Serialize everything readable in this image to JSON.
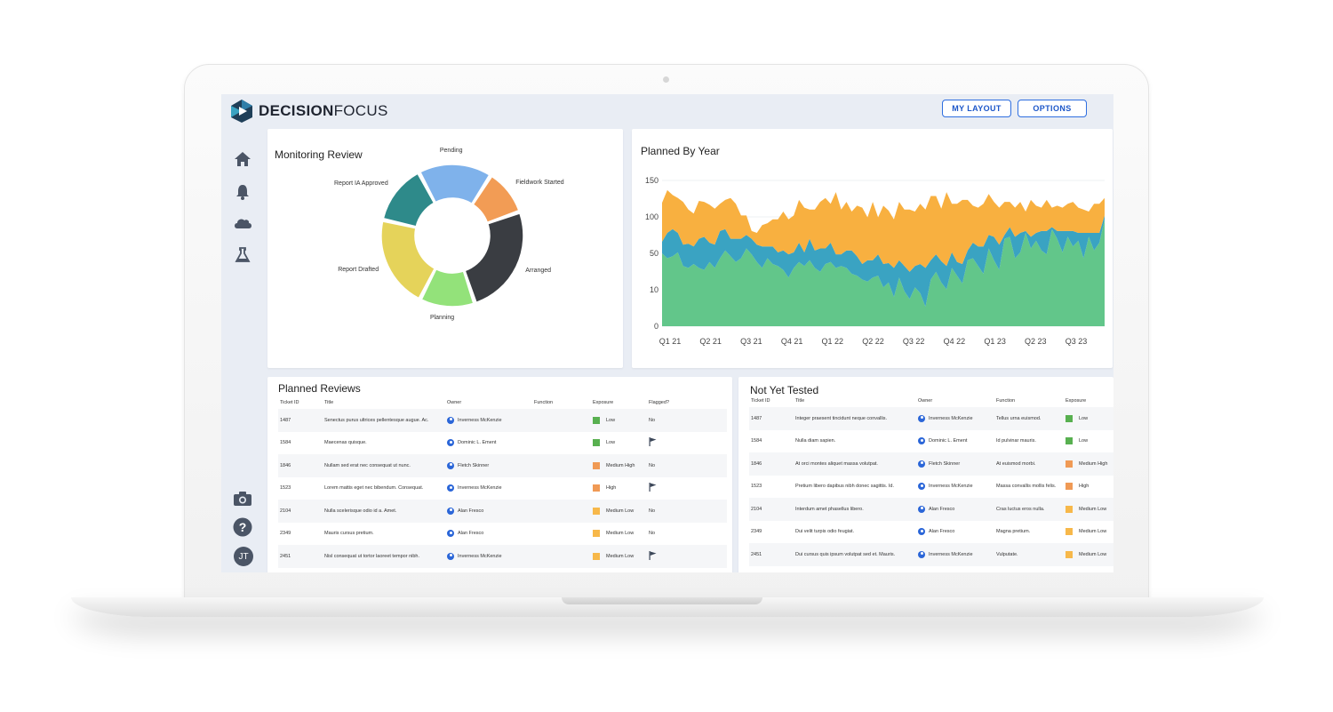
{
  "brand": {
    "name_bold": "DECISION",
    "name_light": "FOCUS"
  },
  "header": {
    "my_layout": "MY LAYOUT",
    "options": "OPTIONS"
  },
  "user": {
    "initials": "JT"
  },
  "icons": [
    "home-icon",
    "bell-icon",
    "cloud-icon",
    "flask-icon",
    "camera-icon",
    "help-icon"
  ],
  "colors": {
    "accent": "#2e6ee0",
    "green": "#62c68a",
    "teal": "#3aa3c2",
    "orange": "#f8b040",
    "exposure_low": "#58b050",
    "exposure_medium_high": "#f09a55",
    "exposure_high": "#f09a55",
    "exposure_medium_low": "#f7b84a"
  },
  "monitoring": {
    "title": "Monitoring Review",
    "chart_data": {
      "type": "pie",
      "donut": true,
      "segments": [
        {
          "label": "Pending",
          "value": 16,
          "color": "#7fb2eb"
        },
        {
          "label": "Fieldwork Started",
          "value": 10,
          "color": "#f29c55"
        },
        {
          "label": "Arranged",
          "value": 24,
          "color": "#3a3d42"
        },
        {
          "label": "Planning",
          "value": 12,
          "color": "#93e27a"
        },
        {
          "label": "Report Drafted",
          "value": 20,
          "color": "#e5d35a"
        },
        {
          "label": "Report IA Approved",
          "value": 13,
          "color": "#2e8a8a"
        }
      ]
    }
  },
  "planned_by_year": {
    "title": "Planned By Year",
    "chart_data": {
      "type": "area",
      "stacked": true,
      "x_categories": [
        "Q1 21",
        "Q2 21",
        "Q3 21",
        "Q4 21",
        "Q1 22",
        "Q2 22",
        "Q3 22",
        "Q4 22",
        "Q1 23",
        "Q2 23",
        "Q3 23"
      ],
      "y_ticks": [
        "0",
        "10",
        "50",
        "100",
        "150"
      ],
      "ylim": [
        0,
        150
      ],
      "series": [
        {
          "color": "#62c68a",
          "values": [
            75,
            70,
            72,
            76,
            62,
            60,
            64,
            60,
            58,
            66,
            60,
            70,
            78,
            72,
            66,
            70,
            80,
            74,
            66,
            60,
            70,
            64,
            62,
            58,
            50,
            60,
            66,
            62,
            68,
            60,
            56,
            64,
            66,
            60,
            62,
            60,
            54,
            52,
            48,
            46,
            50,
            52,
            40,
            45,
            30,
            50,
            36,
            28,
            40,
            34,
            20,
            48,
            56,
            45,
            38,
            60,
            52,
            44,
            68,
            70,
            62,
            54,
            80,
            68,
            58,
            90,
            92,
            70,
            76,
            96,
            80,
            88,
            78,
            74,
            100,
            90,
            76,
            92,
            82,
            88,
            70,
            92,
            78,
            86,
            110
          ]
        },
        {
          "color": "#3aa3c2",
          "values": [
            12,
            26,
            28,
            20,
            22,
            25,
            18,
            30,
            34,
            20,
            24,
            28,
            22,
            18,
            24,
            20,
            14,
            16,
            18,
            22,
            12,
            18,
            14,
            20,
            24,
            16,
            20,
            14,
            22,
            18,
            24,
            16,
            20,
            14,
            12,
            18,
            24,
            20,
            16,
            22,
            18,
            22,
            24,
            20,
            30,
            18,
            26,
            28,
            22,
            30,
            40,
            20,
            18,
            22,
            24,
            16,
            14,
            20,
            10,
            16,
            20,
            28,
            14,
            24,
            26,
            4,
            10,
            22,
            20,
            2,
            12,
            8,
            20,
            24,
            2,
            8,
            22,
            6,
            16,
            8,
            26,
            4,
            18,
            10,
            4
          ]
        },
        {
          "color": "#f8b040",
          "values": [
            40,
            44,
            35,
            36,
            44,
            35,
            34,
            39,
            36,
            39,
            37,
            28,
            30,
            42,
            36,
            24,
            20,
            8,
            12,
            22,
            24,
            28,
            34,
            40,
            36,
            38,
            44,
            46,
            30,
            42,
            48,
            52,
            40,
            64,
            46,
            50,
            40,
            52,
            58,
            44,
            60,
            38,
            60,
            54,
            50,
            60,
            58,
            64,
            56,
            62,
            60,
            66,
            60,
            54,
            76,
            50,
            60,
            66,
            52,
            38,
            40,
            44,
            42,
            36,
            38,
            34,
            26,
            30,
            32,
            20,
            38,
            28,
            24,
            32,
            20,
            26,
            24,
            28,
            30,
            26,
            24,
            22,
            30,
            30,
            18
          ]
        }
      ]
    }
  },
  "planned_reviews": {
    "title": "Planned Reviews",
    "columns": [
      "Ticket ID",
      "Title",
      "Owner",
      "Function",
      "Exposure",
      "Flagged?"
    ],
    "rows": [
      {
        "id": "1487",
        "title": "Senectus purus ultrices pellentesque augue. Ac.",
        "owner": "Inverness McKenzie",
        "function": "",
        "exposure": "Low",
        "exposure_color": "#58b050",
        "flagged": "No",
        "flag_icon": false
      },
      {
        "id": "1584",
        "title": "Maecenas quisque.",
        "owner": "Dominic L. Ement",
        "function": "",
        "exposure": "Low",
        "exposure_color": "#58b050",
        "flagged": "",
        "flag_icon": true
      },
      {
        "id": "1846",
        "title": "Nullam sed erat nec consequat ut nunc.",
        "owner": "Fletch Skinner",
        "function": "",
        "exposure": "Medium High",
        "exposure_color": "#f09a55",
        "flagged": "No",
        "flag_icon": false
      },
      {
        "id": "1523",
        "title": "Lorem mattis eget nec bibendum. Consequat.",
        "owner": "Inverness McKenzie",
        "function": "",
        "exposure": "High",
        "exposure_color": "#f09a55",
        "flagged": "",
        "flag_icon": true
      },
      {
        "id": "2104",
        "title": "Nulla scelerisque odio id a. Amet.",
        "owner": "Alan Fresco",
        "function": "",
        "exposure": "Medium Low",
        "exposure_color": "#f7b84a",
        "flagged": "No",
        "flag_icon": false
      },
      {
        "id": "2349",
        "title": "Mauris cursus pretium.",
        "owner": "Alan Fresco",
        "function": "",
        "exposure": "Medium Low",
        "exposure_color": "#f7b84a",
        "flagged": "No",
        "flag_icon": false
      },
      {
        "id": "2451",
        "title": "Nisl consequat ut tortor laoreet tempor nibh.",
        "owner": "Inverness McKenzie",
        "function": "",
        "exposure": "Medium Low",
        "exposure_color": "#f7b84a",
        "flagged": "",
        "flag_icon": true
      }
    ]
  },
  "not_yet_tested": {
    "title": "Not Yet Tested",
    "columns": [
      "Ticket ID",
      "Title",
      "Owner",
      "Function",
      "Exposure"
    ],
    "rows": [
      {
        "id": "1487",
        "title": "Integer praesent tincidunt neque convallis.",
        "owner": "Inverness McKenzie",
        "function": "Tellus urna euismod.",
        "exposure": "Low",
        "exposure_color": "#58b050"
      },
      {
        "id": "1584",
        "title": "Nulla diam sapien.",
        "owner": "Dominic L. Ement",
        "function": "Id pulvinar mauris.",
        "exposure": "Low",
        "exposure_color": "#58b050"
      },
      {
        "id": "1846",
        "title": "At orci montes aliquet massa volutpat.",
        "owner": "Fletch Skinner",
        "function": "At euismod morbi.",
        "exposure": "Medium High",
        "exposure_color": "#f09a55"
      },
      {
        "id": "1523",
        "title": "Pretium libero dapibus nibh donec sagittis. Id.",
        "owner": "Inverness McKenzie",
        "function": "Massa convallis mollis felis.",
        "exposure": "High",
        "exposure_color": "#f09a55"
      },
      {
        "id": "2104",
        "title": "Interdum amet phasellus libero.",
        "owner": "Alan Fresco",
        "function": "Cras luctus eros nulla.",
        "exposure": "Medium Low",
        "exposure_color": "#f7b84a"
      },
      {
        "id": "2349",
        "title": "Dui velit turpis odio feugiat.",
        "owner": "Alan Fresco",
        "function": "Magna pretium.",
        "exposure": "Medium Low",
        "exposure_color": "#f7b84a"
      },
      {
        "id": "2451",
        "title": "Dui cursus quis ipsum volutpat sed et. Mauris.",
        "owner": "Inverness McKenzie",
        "function": "Vulputate.",
        "exposure": "Medium Low",
        "exposure_color": "#f7b84a"
      }
    ]
  }
}
